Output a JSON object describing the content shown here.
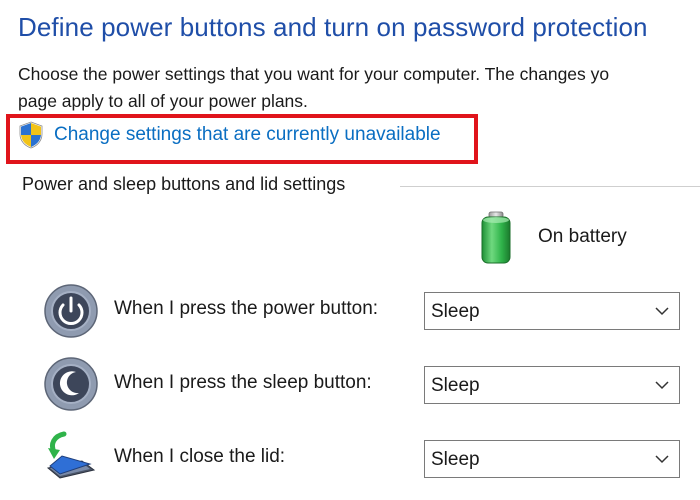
{
  "header": {
    "title": "Define power buttons and turn on password protection"
  },
  "description": {
    "line1": "Choose the power settings that you want for your computer. The changes yo",
    "line2": "page apply to all of your power plans."
  },
  "change_settings": {
    "label": "Change settings that are currently unavailable",
    "icon": "uac-shield-icon"
  },
  "section": {
    "title": "Power and sleep buttons and lid settings"
  },
  "column": {
    "label": "On battery",
    "icon": "battery-icon"
  },
  "rows": [
    {
      "label": "When I press the power button:",
      "value": "Sleep",
      "icon": "power-button-icon"
    },
    {
      "label": "When I press the sleep button:",
      "value": "Sleep",
      "icon": "sleep-button-icon"
    },
    {
      "label": "When I close the lid:",
      "value": "Sleep",
      "icon": "close-lid-icon"
    }
  ],
  "colors": {
    "title": "#1f4ea8",
    "link": "#0a6ec2",
    "highlight": "#e0141b",
    "battery_fill": "#2fb34a"
  }
}
